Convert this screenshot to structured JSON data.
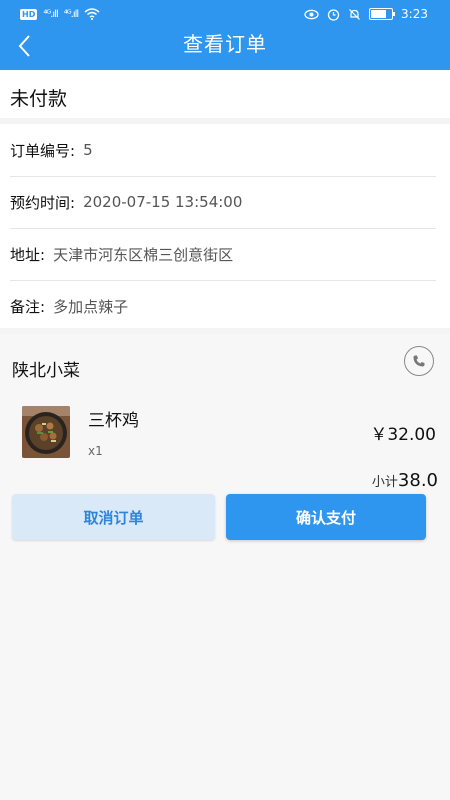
{
  "status_bar": {
    "carrier_badge": "HD",
    "signal_1": "⁴ᴳ.ıll",
    "signal_2": "⁴ᴳ.ıll",
    "time": "3:23"
  },
  "nav": {
    "title": "查看订单",
    "back_icon": "chevron-left-icon"
  },
  "order": {
    "status": "未付款",
    "info": [
      {
        "label": "订单编号:",
        "value": "5"
      },
      {
        "label": "预约时间:",
        "value": "2020-07-15 13:54:00"
      },
      {
        "label": "地址:",
        "value": "天津市河东区棉三创意街区"
      },
      {
        "label": "备注:",
        "value": "多加点辣子"
      }
    ]
  },
  "shop": {
    "name": "陕北小菜",
    "phone_icon": "phone-icon",
    "item": {
      "name": "三杯鸡",
      "qty": "x1",
      "price": "￥32.00"
    },
    "subtotal_label": "小计",
    "subtotal_value": "38.0"
  },
  "actions": {
    "cancel": "取消订单",
    "confirm": "确认支付"
  },
  "colors": {
    "primary": "#2f96f0",
    "cancel_bg": "#d9e9f8",
    "cancel_text": "#2f86d8"
  }
}
